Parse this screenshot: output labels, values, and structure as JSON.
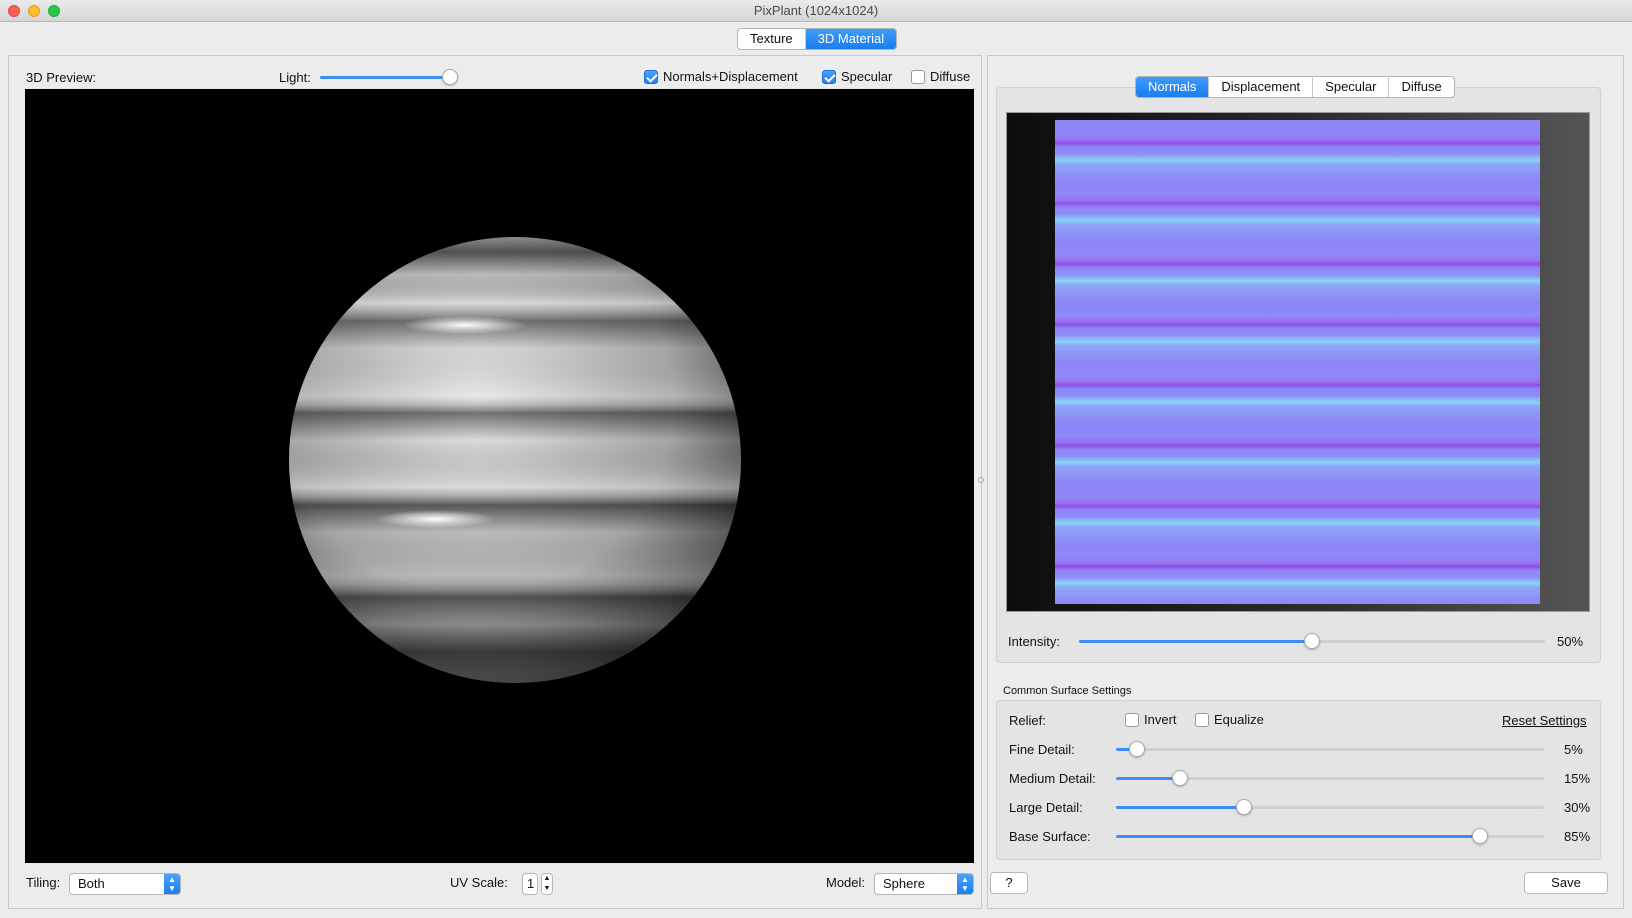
{
  "window": {
    "title": "PixPlant (1024x1024)"
  },
  "top_tabs": [
    {
      "label": "Texture",
      "active": false
    },
    {
      "label": "3D Material",
      "active": true
    }
  ],
  "preview": {
    "label": "3D Preview:",
    "light_label": "Light:",
    "light_value": 0.95,
    "options": [
      {
        "label": "Normals+Displacement",
        "checked": true
      },
      {
        "label": "Specular",
        "checked": true
      },
      {
        "label": "Diffuse",
        "checked": false
      }
    ]
  },
  "bottom_bar": {
    "tiling_label": "Tiling:",
    "tiling_value": "Both",
    "uv_scale_label": "UV Scale:",
    "uv_scale_value": "1",
    "model_label": "Model:",
    "model_value": "Sphere"
  },
  "map_tabs": [
    {
      "label": "Normals",
      "active": true
    },
    {
      "label": "Displacement",
      "active": false
    },
    {
      "label": "Specular",
      "active": false
    },
    {
      "label": "Diffuse",
      "active": false
    }
  ],
  "intensity": {
    "label": "Intensity:",
    "value": 0.5,
    "display": "50%"
  },
  "surface": {
    "title": "Common Surface Settings",
    "relief_label": "Relief:",
    "invert_label": "Invert",
    "invert_checked": false,
    "equalize_label": "Equalize",
    "equalize_checked": false,
    "reset_label": "Reset Settings",
    "sliders": [
      {
        "label": "Fine Detail:",
        "value": 0.05,
        "display": "5%"
      },
      {
        "label": "Medium Detail:",
        "value": 0.15,
        "display": "15%"
      },
      {
        "label": "Large Detail:",
        "value": 0.3,
        "display": "30%"
      },
      {
        "label": "Base Surface:",
        "value": 0.85,
        "display": "85%"
      }
    ]
  },
  "buttons": {
    "help_label": "?",
    "save_label": "Save"
  },
  "colors": {
    "accent": "#1a7ef1",
    "normal_map_base": "#8e86f6"
  }
}
